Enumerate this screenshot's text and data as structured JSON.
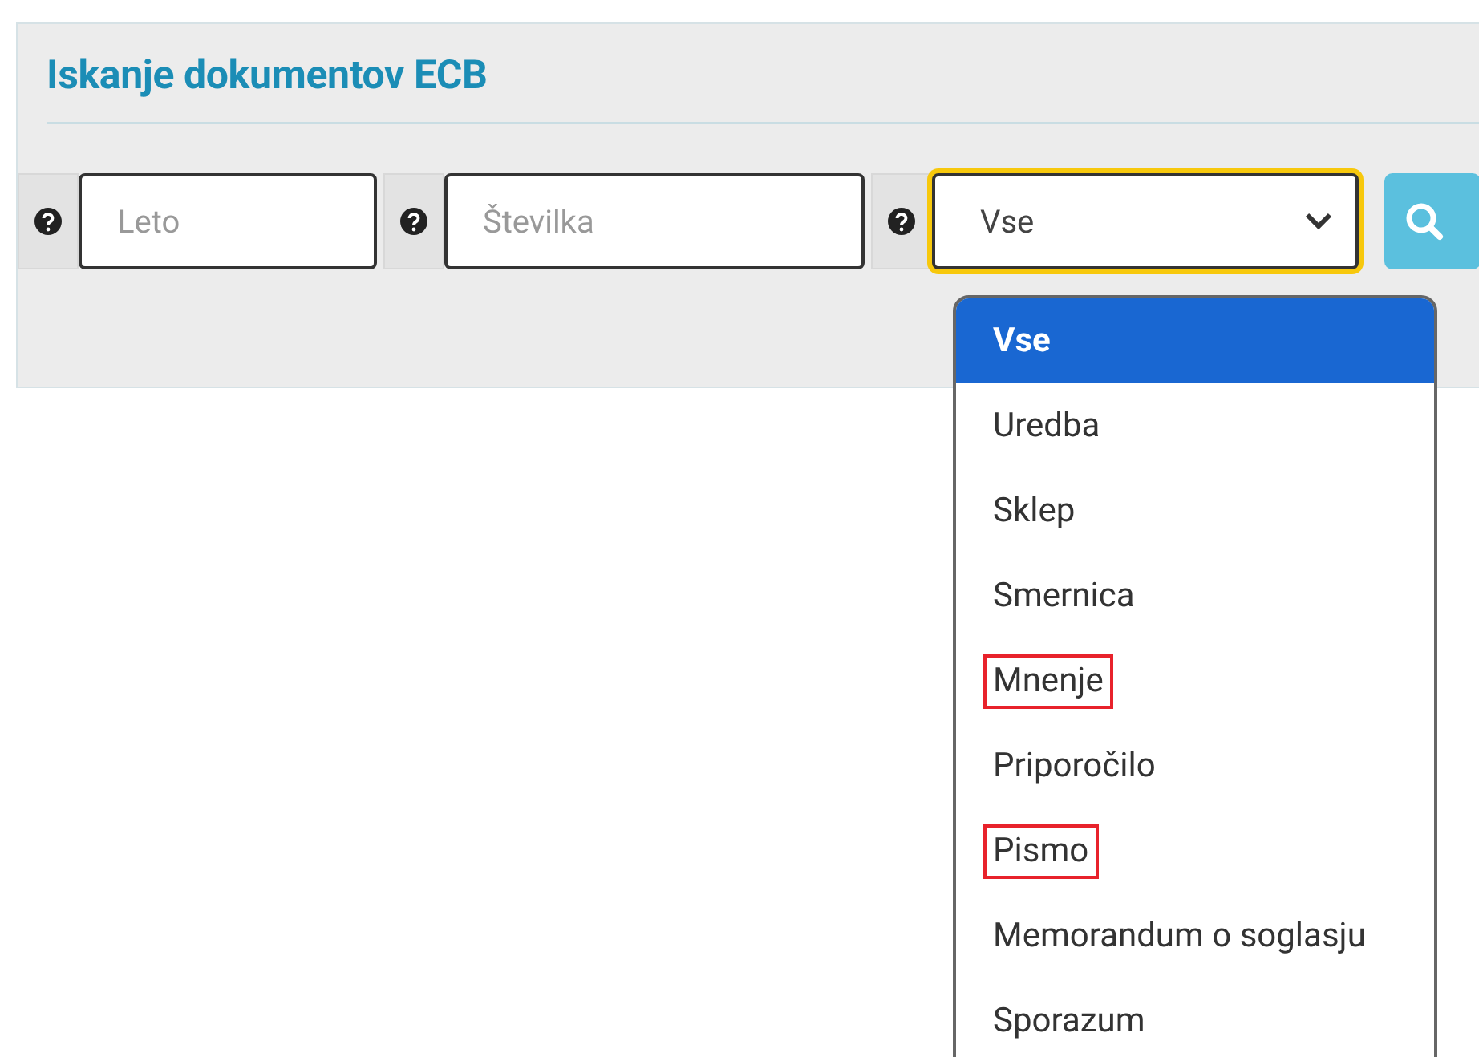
{
  "panel": {
    "title": "Iskanje dokumentov ECB"
  },
  "fields": [
    {
      "kind": "input",
      "placeholder": "Leto"
    },
    {
      "kind": "input",
      "placeholder": "Številka"
    },
    {
      "kind": "select",
      "value": "Vse",
      "focused": true
    }
  ],
  "dropdown": {
    "options": [
      {
        "label": "Vse",
        "selected": true,
        "highlighted": false
      },
      {
        "label": "Uredba",
        "selected": false,
        "highlighted": false
      },
      {
        "label": "Sklep",
        "selected": false,
        "highlighted": false
      },
      {
        "label": "Smernica",
        "selected": false,
        "highlighted": false
      },
      {
        "label": "Mnenje",
        "selected": false,
        "highlighted": true
      },
      {
        "label": "Priporočilo",
        "selected": false,
        "highlighted": false
      },
      {
        "label": "Pismo",
        "selected": false,
        "highlighted": true
      },
      {
        "label": "Memorandum o soglasju",
        "selected": false,
        "highlighted": false
      },
      {
        "label": "Sporazum",
        "selected": false,
        "highlighted": false
      }
    ]
  }
}
